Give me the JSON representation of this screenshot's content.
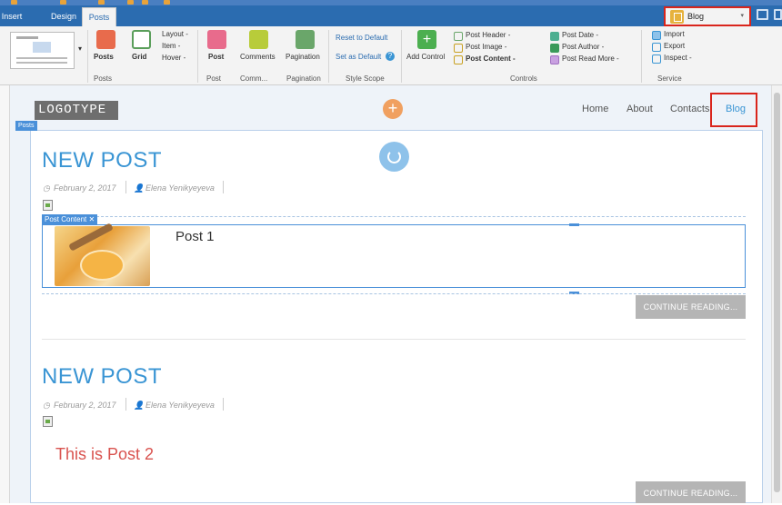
{
  "tabs": {
    "insert": "Insert",
    "design": "Design",
    "posts": "Posts"
  },
  "page_select": {
    "value": "Blog"
  },
  "ribbon": {
    "posts_label": "Posts",
    "grid_label": "Grid",
    "layout_label": "Layout -",
    "item_label": "Item -",
    "hover_label": "Hover -",
    "post_label": "Post",
    "comments_label": "Comments",
    "pagination_label": "Pagination",
    "reset_default": "Reset to Default",
    "set_default": "Set as Default",
    "add_control": "Add Control",
    "post_header": "Post Header -",
    "post_image": "Post Image -",
    "post_content": "Post Content -",
    "post_date": "Post Date -",
    "post_author": "Post Author -",
    "post_read_more": "Post Read More -",
    "import": "Import",
    "export": "Export",
    "inspect": "Inspect -",
    "groups": {
      "posts": "Posts",
      "post": "Post",
      "comm": "Comm...",
      "pagination": "Pagination",
      "style_scope": "Style Scope",
      "controls": "Controls",
      "service": "Service"
    }
  },
  "site": {
    "logo": "LOGOTYPE",
    "nav": [
      "Home",
      "About",
      "Contacts",
      "Blog"
    ],
    "posts_tag": "Posts"
  },
  "posts": [
    {
      "title": "NEW POST",
      "date": "February 2, 2017",
      "author": "Elena Yenikyeyeva",
      "content_tag": "Post Content",
      "content_text": "Post 1",
      "read_more": "CONTINUE READING..."
    },
    {
      "title": "NEW POST",
      "date": "February 2, 2017",
      "author": "Elena Yenikyeyeva",
      "content_text": "This is Post 2",
      "read_more": "CONTINUE READING..."
    }
  ],
  "colors": {
    "accent": "#3a95d4",
    "ribbon_blue": "#2b6cb0",
    "highlight": "#d9251c"
  }
}
